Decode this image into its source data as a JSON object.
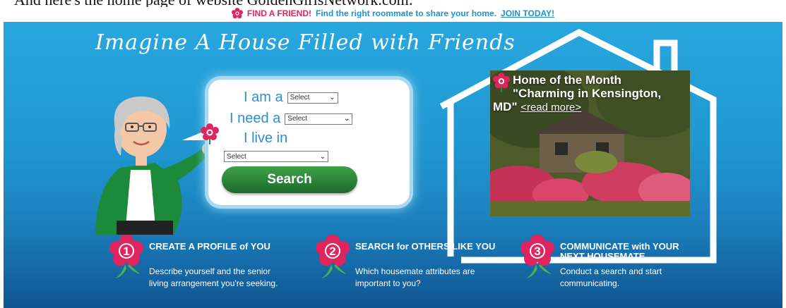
{
  "caption": "And here's the home page of website GoldenGirlsNetwork.com:",
  "topbar": {
    "find": "FIND A FRIEND!",
    "tagline": "Find the right roommate to share your home.",
    "join": "JOIN TODAY!"
  },
  "banner": {
    "headline": "Imagine A House Filled with Friends"
  },
  "form": {
    "i_am_label": "I am a",
    "i_am_value": "Select",
    "i_need_label": "I need a",
    "i_need_value": "Select",
    "i_live_label": "I live in",
    "i_live_value": "Select",
    "search_label": "Search"
  },
  "feature": {
    "line1": "Home of the Month",
    "line2": "\"Charming in Kensington,",
    "line3": "MD\"",
    "read_more": "<read more>"
  },
  "steps": [
    {
      "number": "1",
      "title": "CREATE A PROFILE of YOU",
      "desc": "Describe yourself and the senior living arrangement you're seeking."
    },
    {
      "number": "2",
      "title": "SEARCH for OTHERS LIKE YOU",
      "desc": "Which housemate attributes are important to you?"
    },
    {
      "number": "3",
      "title": "COMMUNICATE with YOUR NEXT HOUSEMATE",
      "desc": "Conduct a search and start communicating."
    }
  ],
  "colors": {
    "banner_blue": "#1f96d1",
    "accent_pink": "#e0245e",
    "link_blue": "#1e93c8",
    "button_green": "#1c6b2b"
  },
  "icons": [
    "flower-icon",
    "dropdown-chevron-icon",
    "house-outline-icon",
    "woman-illustration"
  ]
}
